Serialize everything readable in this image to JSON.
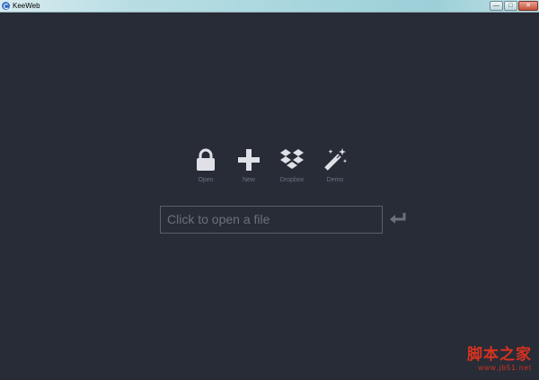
{
  "window": {
    "title": "KeeWeb",
    "controls": {
      "minimize": "—",
      "maximize": "□",
      "close": "✕"
    }
  },
  "actions": [
    {
      "label": "Open",
      "icon": "lock-icon"
    },
    {
      "label": "New",
      "icon": "plus-icon"
    },
    {
      "label": "Dropbox",
      "icon": "dropbox-icon"
    },
    {
      "label": "Demo",
      "icon": "magic-wand-icon"
    }
  ],
  "file_input": {
    "placeholder": "Click to open a file",
    "submit_icon": "enter-return-icon"
  },
  "watermark": {
    "main": "脚本之家",
    "sub": "www.jb51.net"
  },
  "colors": {
    "background": "#282c37",
    "icon": "#dfe1e6",
    "label": "#6b7280",
    "input_border": "#5b606b",
    "watermark": "#d8321f"
  }
}
